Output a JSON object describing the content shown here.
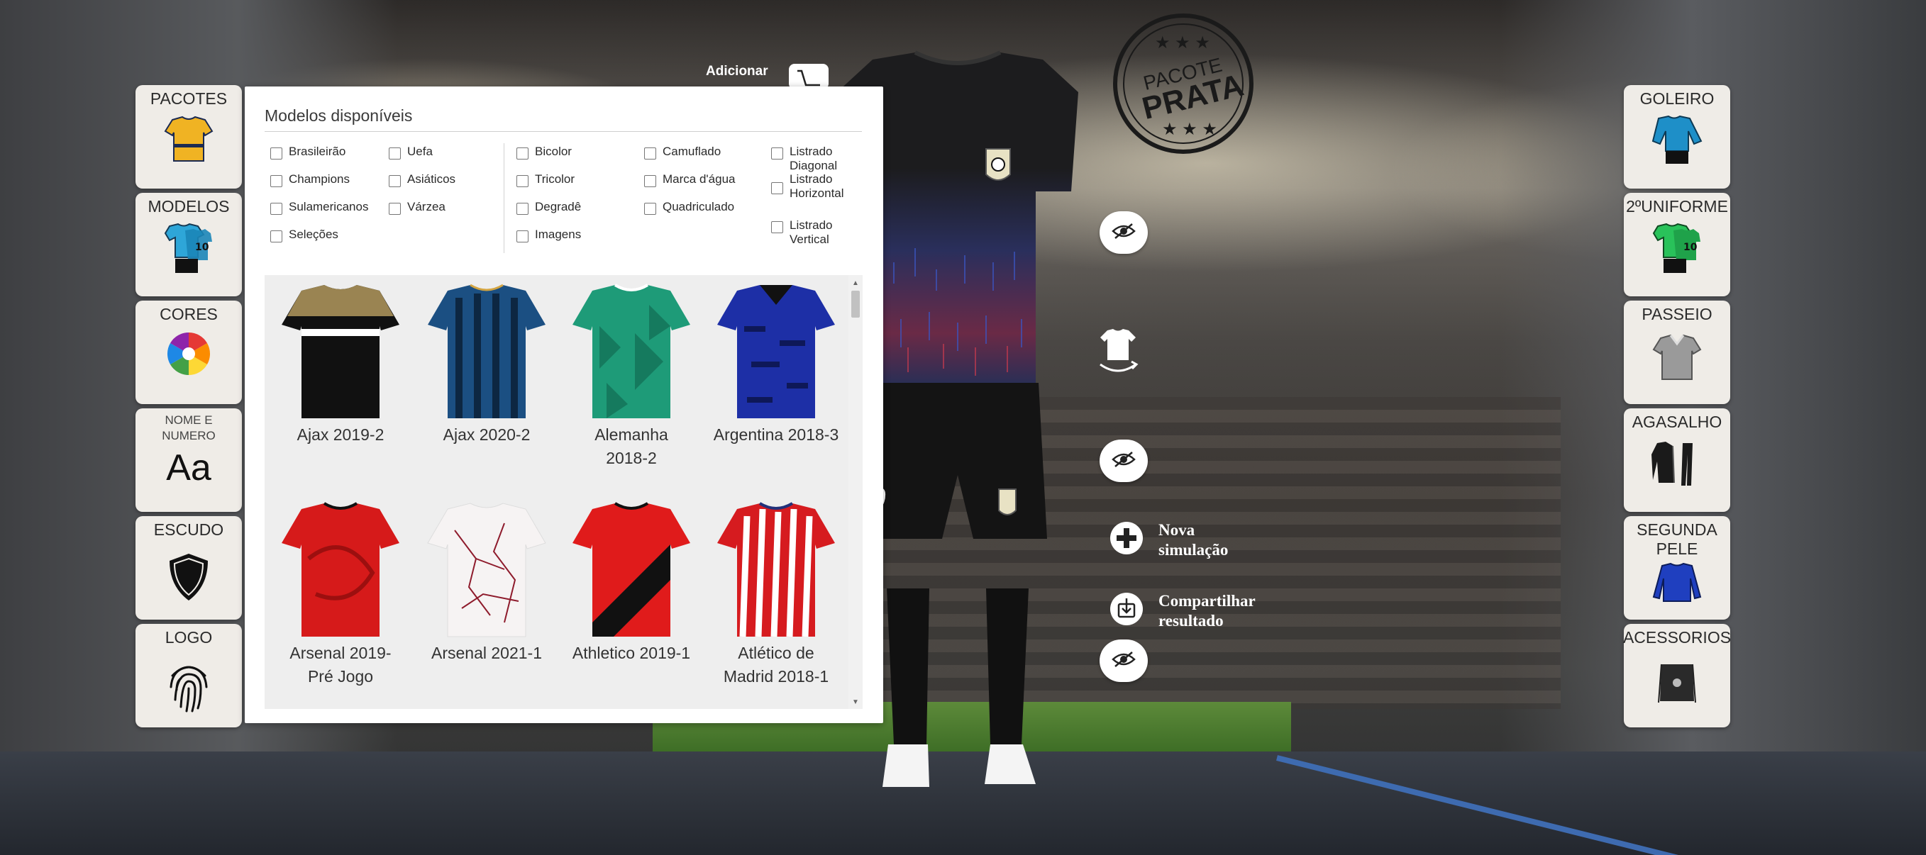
{
  "left_tiles": [
    {
      "label": "PACOTES",
      "icon": "jersey-yellow-icon"
    },
    {
      "label": "MODELOS",
      "icon": "kit-blue-icon"
    },
    {
      "label": "CORES",
      "icon": "color-wheel-icon"
    },
    {
      "label": "NOME E NUMERO",
      "icon": "font-aa-icon",
      "glyph": "Aa"
    },
    {
      "label": "ESCUDO",
      "icon": "shield-icon"
    },
    {
      "label": "LOGO",
      "icon": "fingerprint-icon"
    }
  ],
  "right_tiles": [
    {
      "label": "GOLEIRO",
      "icon": "goalkeeper-kit-icon"
    },
    {
      "label": "2ºUNIFORME",
      "icon": "green-kit-icon"
    },
    {
      "label": "PASSEIO",
      "icon": "polo-shirt-icon"
    },
    {
      "label": "AGASALHO",
      "icon": "tracksuit-icon"
    },
    {
      "label": "SEGUNDA PELE",
      "icon": "compression-shirt-icon"
    },
    {
      "label": "ACESSORIOS",
      "icon": "drawstring-bag-icon"
    }
  ],
  "cart": {
    "label": "Adicionar"
  },
  "badge": {
    "top": "PACOTE",
    "main": "PRATA"
  },
  "panel": {
    "title": "Modelos disponíveis",
    "filters": [
      {
        "label": "Brasileirão",
        "checked": false
      },
      {
        "label": "Champions",
        "checked": false
      },
      {
        "label": "Sulamericanos",
        "checked": false
      },
      {
        "label": "Seleções",
        "checked": false
      },
      {
        "label": "Uefa",
        "checked": false
      },
      {
        "label": "Asiáticos",
        "checked": false
      },
      {
        "label": "Várzea",
        "checked": false
      },
      {
        "label": "Bicolor",
        "checked": false
      },
      {
        "label": "Tricolor",
        "checked": false
      },
      {
        "label": "Degradê",
        "checked": false
      },
      {
        "label": "Imagens",
        "checked": false
      },
      {
        "label": "Camuflado",
        "checked": false
      },
      {
        "label": "Marca d'água",
        "checked": false
      },
      {
        "label": "Quadriculado",
        "checked": false
      },
      {
        "label": "Listrado Diagonal",
        "checked": false
      },
      {
        "label": "Listrado Horizontal",
        "checked": false
      },
      {
        "label": "Listrado Vertical",
        "checked": false
      }
    ],
    "models": [
      {
        "name": "Ajax 2019-2",
        "pattern": "black-gold-band",
        "colors": [
          "#111111",
          "#9a8452",
          "#ffffff"
        ]
      },
      {
        "name": "Ajax 2020-2",
        "pattern": "blue-stripes",
        "colors": [
          "#1b4f82",
          "#0d2742",
          "#d3a441"
        ]
      },
      {
        "name": "Alemanha 2018-2",
        "pattern": "green-geometric",
        "colors": [
          "#1e9b78",
          "#157a5e",
          "#ffffff"
        ]
      },
      {
        "name": "Argentina 2018-3",
        "pattern": "navy-diamonds",
        "colors": [
          "#1d2fa6",
          "#0e1858",
          "#111111"
        ]
      },
      {
        "name": "Arsenal 2019-Pré Jogo",
        "pattern": "red-swirl",
        "colors": [
          "#d61a1a",
          "#9c0f0f",
          "#111111"
        ]
      },
      {
        "name": "Arsenal 2021-1",
        "pattern": "white-marble",
        "colors": [
          "#f6f3f3",
          "#8e1b2c",
          "#f6f3f3"
        ]
      },
      {
        "name": "Athletico 2019-1",
        "pattern": "red-black-diagonal",
        "colors": [
          "#e01b1b",
          "#111111",
          "#111111"
        ]
      },
      {
        "name": "Atlético de Madrid 2018-1",
        "pattern": "red-white-stripes",
        "colors": [
          "#d61b1f",
          "#ffffff",
          "#22317a"
        ]
      }
    ]
  },
  "actions": {
    "new_simulation": "Nova simulação",
    "share_result": "Compartilhar resultado"
  },
  "colors": {
    "tile_bg": "#efece7",
    "panel_bg": "#ffffff",
    "grid_bg": "#eeeeee",
    "kit_primary": "#1a1a1a"
  }
}
